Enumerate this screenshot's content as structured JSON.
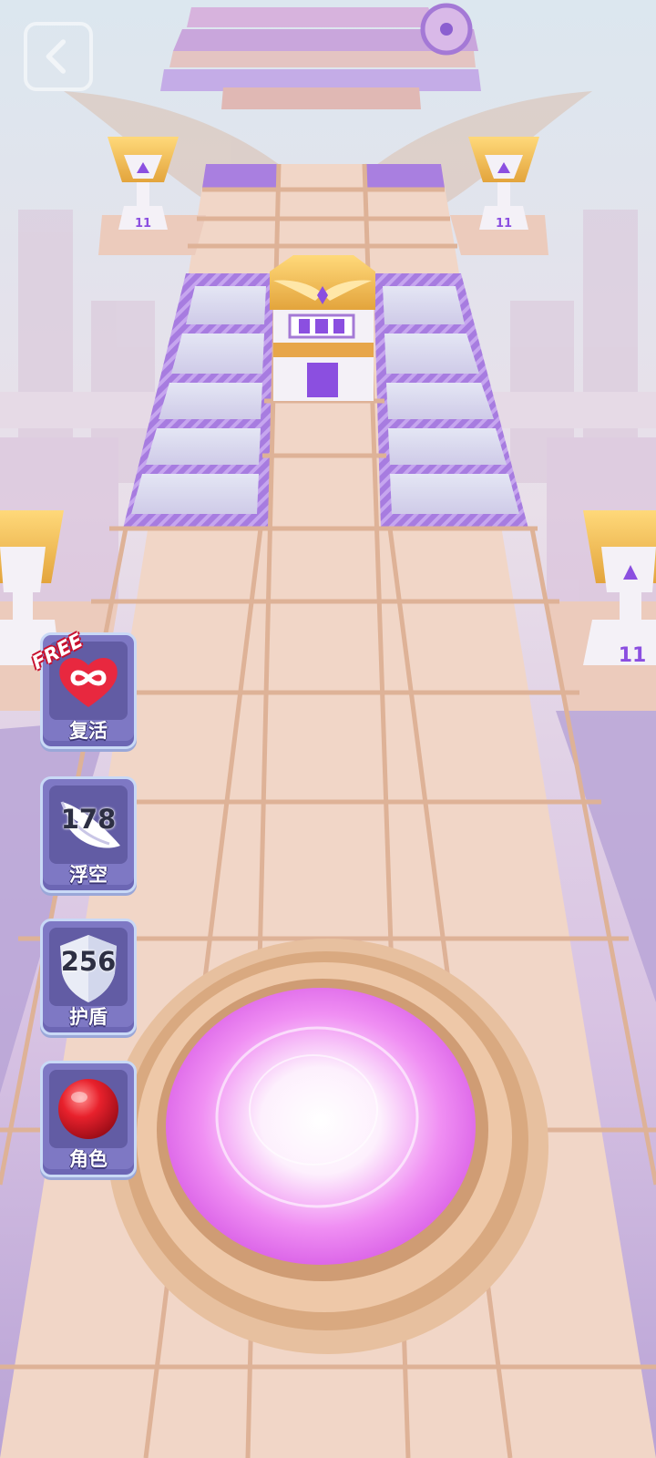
{
  "game": {
    "trophy_number": "11"
  },
  "powerups": [
    {
      "id": "revive",
      "label": "复活",
      "icon": "heart-infinity-icon",
      "badge": "FREE",
      "count": null
    },
    {
      "id": "float",
      "label": "浮空",
      "icon": "wing-icon",
      "badge": null,
      "count": "178"
    },
    {
      "id": "shield",
      "label": "护盾",
      "icon": "shield-icon",
      "badge": null,
      "count": "256"
    },
    {
      "id": "character",
      "label": "角色",
      "icon": "red-ball-icon",
      "badge": null,
      "count": null
    }
  ],
  "colors": {
    "tile": "#f1d3c3",
    "tile_edge": "#e2b496",
    "purple_tile": "#a97fe0",
    "powerup_bg": "#7e78c4",
    "ball_core": "#ffffff",
    "ball_edge": "#e56cf0"
  }
}
